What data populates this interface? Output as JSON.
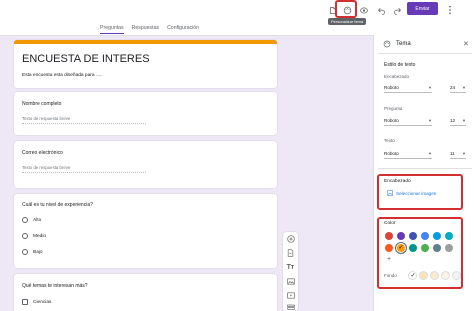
{
  "toolbar": {
    "customize_tooltip": "Personalizar tema",
    "send_label": "Enviar",
    "icons": [
      "addons-icon",
      "palette-icon",
      "preview-icon",
      "undo-icon",
      "redo-icon",
      "more-vert-icon"
    ]
  },
  "tabs": [
    {
      "label": "Preguntas",
      "active": true
    },
    {
      "label": "Respuestas",
      "active": false
    },
    {
      "label": "Configuración",
      "active": false
    }
  ],
  "form": {
    "title": "ENCUESTA DE INTERES",
    "description": "Esta encuesta esta diseñada para .....",
    "questions": [
      {
        "title": "Nombre completo",
        "placeholder": "Texto de respuesta breve"
      },
      {
        "title": "Correo electrónico",
        "placeholder": "Texto de respuesta breve"
      },
      {
        "title": "Cuál es tu nivel de experiencia?",
        "options": [
          "Alto",
          "Medio",
          "Bajo"
        ]
      },
      {
        "title": "Qué temas te interesan más?",
        "options": [
          "Ciencias"
        ]
      }
    ]
  },
  "panel": {
    "title": "Tema",
    "text_style_header": "Estilo de texto",
    "header_label": "Encabezado",
    "header_font": "Roboto",
    "header_size": "24",
    "question_label": "Pregunta",
    "question_font": "Roboto",
    "question_size": "12",
    "text_label": "Texto",
    "text_font": "Roboto",
    "text_size": "11",
    "header_section": "Encabezado",
    "select_image": "Seleccionar imagen",
    "color_section": "Color",
    "add_color": "+",
    "background_label": "Fondo",
    "colors": [
      "#db4437",
      "#673ab7",
      "#3f51b5",
      "#4285f4",
      "#039be5",
      "#00acc1",
      "#ff5722",
      "#ff9800",
      "#009688",
      "#4caf50",
      "#607d8b",
      "#9e9e9e"
    ],
    "background_colors": [
      "#ffffff",
      "#fbe3b8",
      "#fdebd0",
      "#fdf3e4",
      "#f1f3f4"
    ]
  }
}
